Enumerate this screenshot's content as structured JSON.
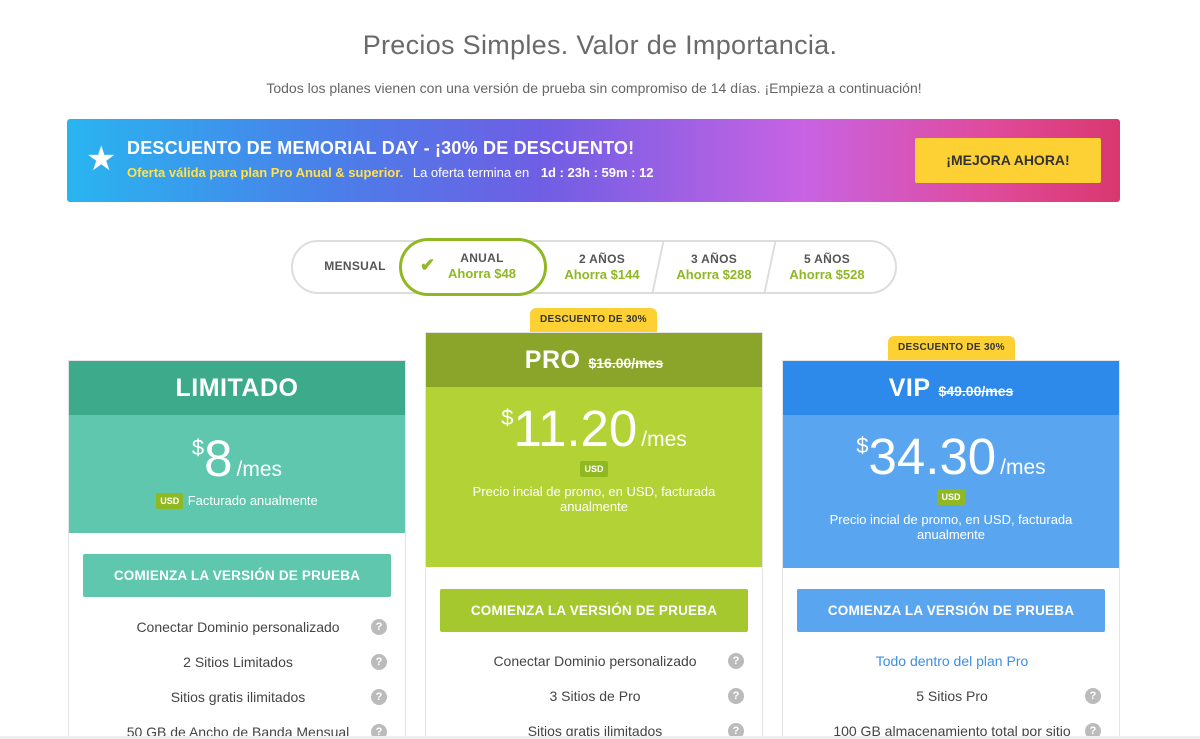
{
  "header": {
    "title": "Precios Simples. Valor de Importancia.",
    "subtitle": "Todos los planes vienen con una versión de prueba sin compromiso de 14 días. ¡Empieza a continuación!"
  },
  "promo": {
    "star_icon": "star-icon",
    "headline": "DESCUENTO DE MEMORIAL DAY - ¡30% DE DESCUENTO!",
    "offer_text": "Oferta válida para plan Pro Anual & superior.",
    "ends_text": "La oferta termina en",
    "countdown": "1d : 23h : 59m : 12",
    "button_label": "¡MEJORA AHORA!"
  },
  "billing_toggle": {
    "options": [
      {
        "label": "MENSUAL",
        "savings": ""
      },
      {
        "label": "ANUAL",
        "savings": "Ahorra $48"
      },
      {
        "label": "2 AÑOS",
        "savings": "Ahorra $144"
      },
      {
        "label": "3 AÑOS",
        "savings": "Ahorra $288"
      },
      {
        "label": "5 AÑOS",
        "savings": "Ahorra $528"
      }
    ],
    "selected": "ANUAL"
  },
  "plans": [
    {
      "name": "LIMITADO",
      "old_price": "",
      "currency_symbol": "$",
      "price": "8",
      "per": "/mes",
      "usd_badge": "USD",
      "billing_note": "Facturado anualmente",
      "cta_label": "COMIENZA LA VERSIÓN DE PRUEBA",
      "features": [
        "Conectar Dominio personalizado",
        "2 Sitios Limitados",
        "Sitios gratis ilimitados",
        "50 GB de Ancho de Banda Mensual"
      ],
      "colors": {
        "head": "#3daa8b",
        "body": "#5ec7ae",
        "button": "#5ec7ae"
      }
    },
    {
      "name": "PRO",
      "badge": "DESCUENTO DE 30%",
      "old_price": "$16.00/mes",
      "currency_symbol": "$",
      "price": "11.20",
      "per": "/mes",
      "usd_badge": "USD",
      "billing_note": "Precio incial de promo, en USD, facturada anualmente",
      "cta_label": "COMIENZA LA VERSIÓN DE PRUEBA",
      "features": [
        "Conectar Dominio personalizado",
        "3 Sitios de Pro",
        "Sitios gratis ilimitados"
      ],
      "colors": {
        "head": "#8ba52a",
        "body": "#b2d235",
        "button": "#a5c82e"
      }
    },
    {
      "name": "VIP",
      "badge": "DESCUENTO DE 30%",
      "old_price": "$49.00/mes",
      "currency_symbol": "$",
      "price": "34.30",
      "per": "/mes",
      "usd_badge": "USD",
      "billing_note": "Precio incial de promo, en USD, facturada anualmente",
      "cta_label": "COMIENZA LA VERSIÓN DE PRUEBA",
      "features": [
        "Todo dentro del plan Pro",
        "5 Sitios Pro",
        "100 GB almacenamiento total por sitio"
      ],
      "colors": {
        "head": "#2d8aea",
        "body": "#5aa5f0",
        "button": "#5aa5f0"
      }
    }
  ],
  "icons": {
    "question": "?",
    "check": "✔",
    "star": "★"
  }
}
